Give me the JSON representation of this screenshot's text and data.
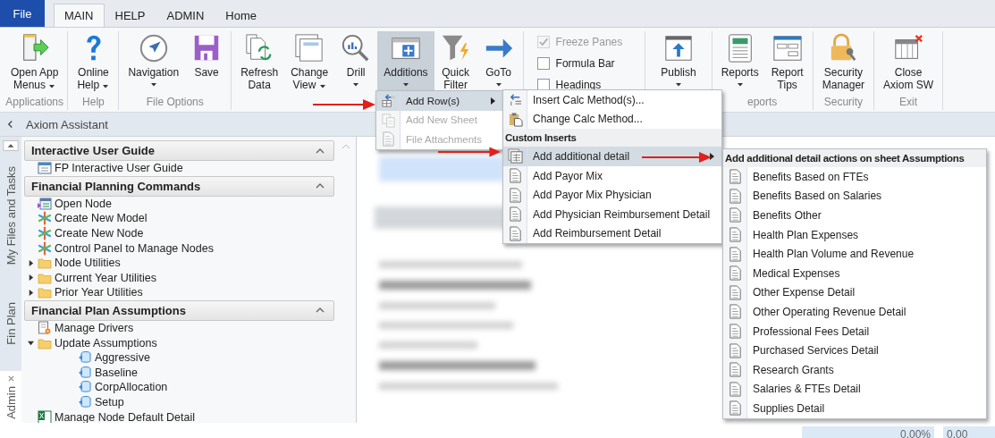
{
  "tabs": [
    {
      "label": "File",
      "kind": "file",
      "selected": false
    },
    {
      "label": "MAIN",
      "kind": "tab",
      "selected": true
    },
    {
      "label": "HELP",
      "kind": "tab",
      "selected": false
    },
    {
      "label": "ADMIN",
      "kind": "tab",
      "selected": false
    },
    {
      "label": "Home",
      "kind": "tab",
      "selected": false
    }
  ],
  "ribbon_groups": [
    {
      "label": "Applications",
      "items": [
        {
          "kind": "button",
          "label": "Open App\nMenus",
          "dropdown": true,
          "selected": false
        }
      ]
    },
    {
      "label": "Help",
      "items": [
        {
          "kind": "button",
          "label": "Online\nHelp",
          "dropdown": true,
          "selected": false
        }
      ]
    },
    {
      "label": "File Options",
      "items": [
        {
          "kind": "button",
          "label": "Navigation",
          "dropdown": true,
          "selected": false
        },
        {
          "kind": "button",
          "label": "Save",
          "dropdown": false,
          "selected": false
        }
      ]
    },
    {
      "items": [
        {
          "kind": "button",
          "label": "Refresh\nData",
          "dropdown": false,
          "selected": false
        },
        {
          "kind": "button",
          "label": "Change\nView",
          "dropdown": true,
          "selected": false
        },
        {
          "kind": "button",
          "label": "Drill",
          "dropdown": true,
          "selected": false
        },
        {
          "kind": "button",
          "label": "Additions",
          "dropdown": true,
          "selected": true
        },
        {
          "kind": "button",
          "label": "Quick\nFilter",
          "dropdown": false,
          "selected": false
        },
        {
          "kind": "button",
          "label": "GoTo",
          "dropdown": true,
          "selected": false
        }
      ]
    },
    {
      "items": [
        {
          "kind": "checkbox",
          "label": "Freeze Panes",
          "checked": true,
          "disabled": true
        },
        {
          "kind": "checkbox",
          "label": "Formula Bar",
          "checked": false,
          "disabled": false
        },
        {
          "kind": "checkbox",
          "label": "Headings",
          "checked": false,
          "disabled": false
        }
      ]
    },
    {
      "items": [
        {
          "kind": "button",
          "label": "Publish",
          "dropdown": true,
          "selected": false
        }
      ]
    },
    {
      "label": "eports",
      "items": [
        {
          "kind": "button",
          "label": "Reports",
          "dropdown": true,
          "selected": false
        },
        {
          "kind": "button",
          "label": "Report\nTips",
          "dropdown": false,
          "selected": false
        }
      ]
    },
    {
      "label": "Security",
      "items": [
        {
          "kind": "button",
          "label": "Security\nManager",
          "dropdown": false,
          "selected": false
        }
      ]
    },
    {
      "label": "Exit",
      "items": [
        {
          "kind": "button",
          "label": "Close\nAxiom SW",
          "dropdown": false,
          "selected": false
        }
      ]
    }
  ],
  "assistant": {
    "title": "Axiom Assistant",
    "side_tabs": [
      {
        "label": "My Files and Tasks",
        "selected": false
      },
      {
        "label": "Fin Plan",
        "selected": false
      },
      {
        "label": "Admin",
        "selected": true
      }
    ],
    "sections": [
      {
        "title": "Interactive User Guide",
        "expanded": true,
        "items": [
          {
            "label": "FP Interactive User Guide"
          }
        ]
      },
      {
        "title": "Financial Planning Commands",
        "expanded": true,
        "items": [
          {
            "label": "Open Node"
          },
          {
            "label": "Create New Model"
          },
          {
            "label": "Create New Node"
          },
          {
            "label": "Control Panel to Manage Nodes"
          },
          {
            "label": "Node Utilities",
            "expanded": false
          },
          {
            "label": "Current Year Utilities",
            "expanded": false
          },
          {
            "label": "Prior Year Utilities",
            "expanded": false
          }
        ]
      },
      {
        "title": "Financial Plan Assumptions",
        "expanded": true,
        "items": [
          {
            "label": "Manage Drivers"
          },
          {
            "label": "Update Assumptions",
            "expanded": true,
            "children": [
              {
                "label": "Aggressive"
              },
              {
                "label": "Baseline"
              },
              {
                "label": "CorpAllocation"
              },
              {
                "label": "Setup"
              }
            ]
          },
          {
            "label": "Manage Node Default Detail"
          }
        ]
      }
    ]
  },
  "sheet": {
    "cells": [
      "0.00%",
      "0.00"
    ]
  },
  "menus": [
    {
      "items": [
        {
          "kind": "item",
          "label": "Add Row(s)",
          "selected": true,
          "disabled": false,
          "submenu": true
        },
        {
          "kind": "item",
          "label": "Add New Sheet",
          "selected": false,
          "disabled": true,
          "submenu": false
        },
        {
          "kind": "item",
          "label": "File Attachments",
          "selected": false,
          "disabled": true,
          "submenu": false
        }
      ]
    },
    {
      "items": [
        {
          "kind": "item",
          "label": "Insert Calc Method(s)...",
          "selected": false,
          "disabled": false,
          "submenu": false
        },
        {
          "kind": "item",
          "label": "Change Calc Method...",
          "selected": false,
          "disabled": false,
          "submenu": false
        },
        {
          "kind": "header",
          "label": "Custom Inserts"
        },
        {
          "kind": "item",
          "label": "Add additional detail",
          "selected": true,
          "disabled": false,
          "submenu": true
        },
        {
          "kind": "item",
          "label": "Add Payor Mix",
          "selected": false,
          "disabled": false,
          "submenu": false
        },
        {
          "kind": "item",
          "label": "Add Payor Mix Physician",
          "selected": false,
          "disabled": false,
          "submenu": false
        },
        {
          "kind": "item",
          "label": "Add Physician Reimbursement Detail",
          "selected": false,
          "disabled": false,
          "submenu": false
        },
        {
          "kind": "item",
          "label": "Add Reimbursement Detail",
          "selected": false,
          "disabled": false,
          "submenu": false
        }
      ]
    },
    {
      "items": [
        {
          "kind": "header",
          "label": "Add additional detail actions on sheet Assumptions"
        },
        {
          "kind": "item",
          "label": "Benefits Based on FTEs",
          "selected": false,
          "disabled": false,
          "submenu": false
        },
        {
          "kind": "item",
          "label": "Benefits Based on Salaries",
          "selected": false,
          "disabled": false,
          "submenu": false
        },
        {
          "kind": "item",
          "label": "Benefits Other",
          "selected": false,
          "disabled": false,
          "submenu": false
        },
        {
          "kind": "item",
          "label": "Health Plan Expenses",
          "selected": false,
          "disabled": false,
          "submenu": false
        },
        {
          "kind": "item",
          "label": "Health Plan Volume and Revenue",
          "selected": false,
          "disabled": false,
          "submenu": false
        },
        {
          "kind": "item",
          "label": "Medical Expenses",
          "selected": false,
          "disabled": false,
          "submenu": false
        },
        {
          "kind": "item",
          "label": "Other Expense Detail",
          "selected": false,
          "disabled": false,
          "submenu": false
        },
        {
          "kind": "item",
          "label": "Other Operating Revenue Detail",
          "selected": false,
          "disabled": false,
          "submenu": false
        },
        {
          "kind": "item",
          "label": "Professional Fees Detail",
          "selected": false,
          "disabled": false,
          "submenu": false
        },
        {
          "kind": "item",
          "label": "Purchased Services Detail",
          "selected": false,
          "disabled": false,
          "submenu": false
        },
        {
          "kind": "item",
          "label": "Research Grants",
          "selected": false,
          "disabled": false,
          "submenu": false
        },
        {
          "kind": "item",
          "label": "Salaries & FTEs Detail",
          "selected": false,
          "disabled": false,
          "submenu": false
        },
        {
          "kind": "item",
          "label": "Supplies Detail",
          "selected": false,
          "disabled": false,
          "submenu": false
        }
      ]
    }
  ]
}
